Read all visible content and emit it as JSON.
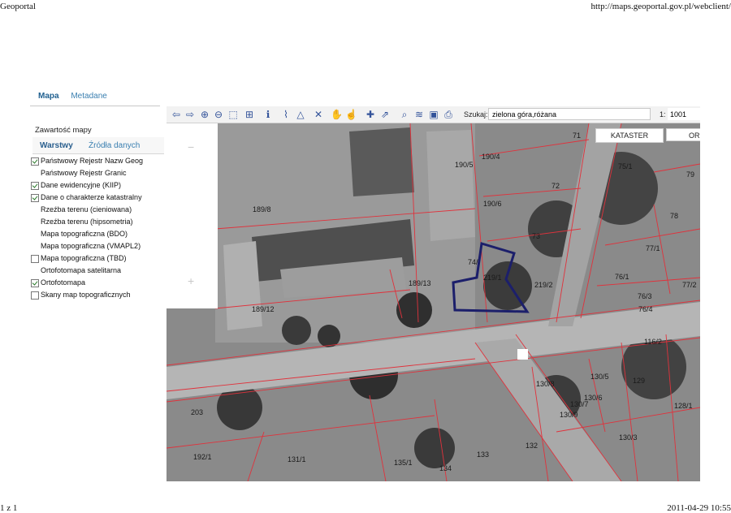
{
  "print_header": {
    "title": "Geoportal",
    "url": "http://maps.geoportal.gov.pl/webclient/"
  },
  "print_footer": {
    "page": "1 z 1",
    "datetime": "2011-04-29 10:55"
  },
  "main_tabs": {
    "active": "Mapa",
    "inactive": "Metadane"
  },
  "panel": {
    "title": "Zawartość mapy",
    "subtabs": {
      "active": "Warstwy",
      "inactive": "Źródła danych"
    },
    "layers": [
      {
        "label": "Państwowy Rejestr Nazw Geog",
        "checkbox": true,
        "checked": true
      },
      {
        "label": "Państwowy Rejestr Granic",
        "checkbox": false,
        "checked": false
      },
      {
        "label": "Dane ewidencyjne (KIIP)",
        "checkbox": true,
        "checked": true
      },
      {
        "label": "Dane o charakterze katastralny",
        "checkbox": true,
        "checked": true
      },
      {
        "label": "Rzeźba terenu (cieniowana)",
        "checkbox": false,
        "checked": false
      },
      {
        "label": "Rzeźba terenu (hipsometria)",
        "checkbox": false,
        "checked": false
      },
      {
        "label": "Mapa topograficzna (BDO)",
        "checkbox": false,
        "checked": false
      },
      {
        "label": "Mapa topograficzna (VMAPL2)",
        "checkbox": false,
        "checked": false
      },
      {
        "label": "Mapa topograficzna (TBD)",
        "checkbox": true,
        "checked": false
      },
      {
        "label": "Ortofotomapa satelitarna",
        "checkbox": false,
        "checked": false
      },
      {
        "label": "Ortofotomapa",
        "checkbox": true,
        "checked": true
      },
      {
        "label": "Skany map topograficznych",
        "checkbox": true,
        "checked": false
      }
    ]
  },
  "toolbar": {
    "icons": [
      "back-arrow-icon",
      "forward-arrow-icon",
      "zoom-in-icon",
      "zoom-out-icon",
      "zoom-box-icon",
      "full-extent-icon",
      "info-icon",
      "measure-distance-icon",
      "measure-area-icon",
      "clear-measure-icon",
      "pan-hand-icon",
      "select-hand-icon",
      "add-layer-icon",
      "export-icon",
      "search-map-icon",
      "layers-icon",
      "save-icon",
      "print-icon"
    ],
    "search_label": "Szukaj:",
    "search_value": "zielona góra,różana",
    "scale_prefix": "1:",
    "scale_value": "1001"
  },
  "map": {
    "buttons": {
      "kataster": "KATASTER",
      "orto": "OR"
    },
    "zoom": {
      "minus": "−",
      "plus": "+"
    },
    "colors": {
      "parcel_lines": "#e0323c",
      "selected_parcel": "#1c1f6b"
    },
    "parcel_labels": [
      {
        "t": "71"
      },
      {
        "t": "190/4"
      },
      {
        "t": "190/5"
      },
      {
        "t": "75/1"
      },
      {
        "t": "79"
      },
      {
        "t": "72"
      },
      {
        "t": "189/8"
      },
      {
        "t": "190/6"
      },
      {
        "t": "78"
      },
      {
        "t": "73"
      },
      {
        "t": "77/1"
      },
      {
        "t": "74/"
      },
      {
        "t": "219/1"
      },
      {
        "t": "219/2"
      },
      {
        "t": "189/13"
      },
      {
        "t": "76/1"
      },
      {
        "t": "77/2"
      },
      {
        "t": "76/3"
      },
      {
        "t": "189/12"
      },
      {
        "t": "76/4"
      },
      {
        "t": "116/2"
      },
      {
        "t": "130/8"
      },
      {
        "t": "130/5"
      },
      {
        "t": "129"
      },
      {
        "t": "130/6"
      },
      {
        "t": "130/7"
      },
      {
        "t": "130/9"
      },
      {
        "t": "128/1"
      },
      {
        "t": "203"
      },
      {
        "t": "130/3"
      },
      {
        "t": "132"
      },
      {
        "t": "133"
      },
      {
        "t": "192/1"
      },
      {
        "t": "131/1"
      },
      {
        "t": "135/1"
      },
      {
        "t": "134"
      }
    ]
  }
}
